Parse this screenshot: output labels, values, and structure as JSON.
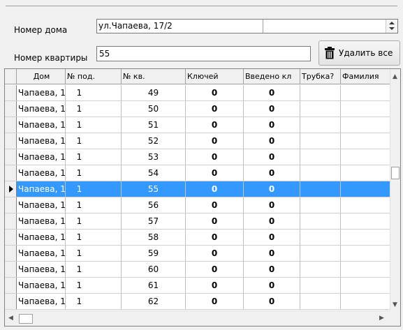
{
  "form": {
    "house_label": "Номер дома",
    "house_value": "ул.Чапаева, 17/2",
    "apartment_label": "Номер квартиры",
    "apartment_value": "55",
    "delete_all_label": "Удалить все"
  },
  "grid": {
    "columns": [
      "Дом",
      "№ под.",
      "№ кв.",
      "Ключей",
      "Введено кл",
      "Трубка?",
      "Фамилия"
    ],
    "selected_index": 6,
    "rows": [
      [
        "Чапаева, 1",
        "1",
        "49",
        "0",
        "0"
      ],
      [
        "Чапаева, 1",
        "1",
        "50",
        "0",
        "0"
      ],
      [
        "Чапаева, 1",
        "1",
        "51",
        "0",
        "0"
      ],
      [
        "Чапаева, 1",
        "1",
        "52",
        "0",
        "0"
      ],
      [
        "Чапаева, 1",
        "1",
        "53",
        "0",
        "0"
      ],
      [
        "Чапаева, 1",
        "1",
        "54",
        "0",
        "0"
      ],
      [
        "Чапаева, 1",
        "1",
        "55",
        "0",
        "0"
      ],
      [
        "Чапаева, 1",
        "1",
        "56",
        "0",
        "0"
      ],
      [
        "Чапаева, 1",
        "1",
        "57",
        "0",
        "0"
      ],
      [
        "Чапаева, 1",
        "1",
        "58",
        "0",
        "0"
      ],
      [
        "Чапаева, 1",
        "1",
        "59",
        "0",
        "0"
      ],
      [
        "Чапаева, 1",
        "1",
        "60",
        "0",
        "0"
      ],
      [
        "Чапаева, 1",
        "1",
        "61",
        "0",
        "0"
      ],
      [
        "Чапаева, 1",
        "1",
        "62",
        "0",
        "0"
      ]
    ]
  },
  "icons": {
    "delete": "trash-icon",
    "row_pointer": "row-pointer-icon",
    "spin": "spin-arrows-icon"
  },
  "colors": {
    "selection": "#3399ff"
  }
}
